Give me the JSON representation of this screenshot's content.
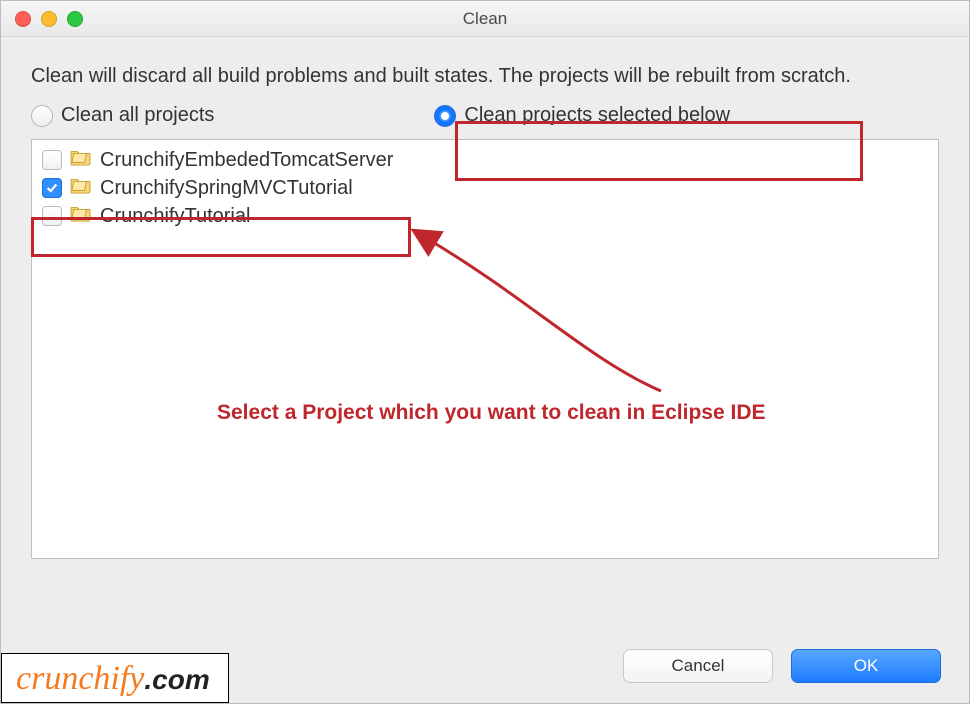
{
  "window": {
    "title": "Clean"
  },
  "description": "Clean will discard all build problems and built states.  The projects will be rebuilt from scratch.",
  "radios": {
    "all_label": "Clean all projects",
    "selected_label": "Clean projects selected below"
  },
  "projects": [
    {
      "name": "CrunchifyEmbededTomcatServer",
      "checked": false
    },
    {
      "name": "CrunchifySpringMVCTutorial",
      "checked": true
    },
    {
      "name": "CrunchifyTutorial",
      "checked": false
    }
  ],
  "buttons": {
    "cancel": "Cancel",
    "ok": "OK"
  },
  "annotation": {
    "text": "Select a Project which you want to clean in Eclipse IDE"
  },
  "watermark": {
    "part1": "crunchify",
    "part2": ".com"
  }
}
